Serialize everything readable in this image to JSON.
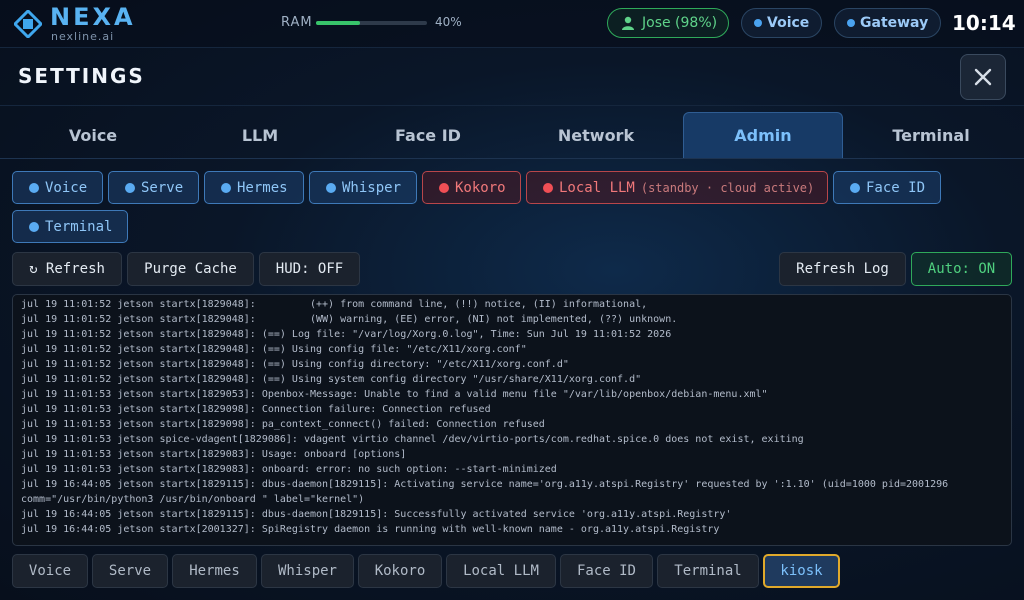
{
  "topbar": {
    "brand": "NEXA",
    "brand_sub": "nexline.ai",
    "ram_label": "RAM",
    "ram_value": 0.4,
    "ram_pct_text": "40%",
    "user_label": "Jose (98%)",
    "voice_label": "Voice",
    "gateway_label": "Gateway",
    "clock": "10:14",
    "colors": {
      "accent": "#59b3f2",
      "ok": "#38c46a",
      "error": "#f04f55"
    }
  },
  "settings": {
    "title": "SETTINGS",
    "close_icon": "close-icon"
  },
  "tabs": [
    "Voice",
    "LLM",
    "Face ID",
    "Network",
    "Admin",
    "Terminal"
  ],
  "active_tab": "Admin",
  "services": [
    {
      "label": "Voice",
      "status": "running"
    },
    {
      "label": "Serve",
      "status": "running"
    },
    {
      "label": "Hermes",
      "status": "running"
    },
    {
      "label": "Whisper",
      "status": "running"
    },
    {
      "label": "Kokoro",
      "status": "stopped"
    },
    {
      "label": "Local LLM",
      "note": "(standby · cloud active)",
      "status": "stopped"
    },
    {
      "label": "Face ID",
      "status": "running"
    },
    {
      "label": "Terminal",
      "status": "running"
    }
  ],
  "actions": {
    "refresh": "↻ Refresh",
    "purge_cache": "Purge Cache",
    "hud": "HUD: OFF",
    "refresh_log": "Refresh Log",
    "auto": "Auto: ON"
  },
  "log_lines": [
    "jul 19 11:01:52 jetson startx[1829048]:         (++) from command line, (!!) notice, (II) informational,",
    "jul 19 11:01:52 jetson startx[1829048]:         (WW) warning, (EE) error, (NI) not implemented, (??) unknown.",
    "jul 19 11:01:52 jetson startx[1829048]: (==) Log file: \"/var/log/Xorg.0.log\", Time: Sun Jul 19 11:01:52 2026",
    "jul 19 11:01:52 jetson startx[1829048]: (==) Using config file: \"/etc/X11/xorg.conf\"",
    "jul 19 11:01:52 jetson startx[1829048]: (==) Using config directory: \"/etc/X11/xorg.conf.d\"",
    "jul 19 11:01:52 jetson startx[1829048]: (==) Using system config directory \"/usr/share/X11/xorg.conf.d\"",
    "jul 19 11:01:53 jetson startx[1829053]: Openbox-Message: Unable to find a valid menu file \"/var/lib/openbox/debian-menu.xml\"",
    "jul 19 11:01:53 jetson startx[1829098]: Connection failure: Connection refused",
    "jul 19 11:01:53 jetson startx[1829098]: pa_context_connect() failed: Connection refused",
    "jul 19 11:01:53 jetson spice-vdagent[1829086]: vdagent virtio channel /dev/virtio-ports/com.redhat.spice.0 does not exist, exiting",
    "jul 19 11:01:53 jetson startx[1829083]: Usage: onboard [options]",
    "jul 19 11:01:53 jetson startx[1829083]: onboard: error: no such option: --start-minimized",
    "jul 19 16:44:05 jetson startx[1829115]: dbus-daemon[1829115]: Activating service name='org.a11y.atspi.Registry' requested by ':1.10' (uid=1000 pid=2001296",
    "comm=\"/usr/bin/python3 /usr/bin/onboard \" label=\"kernel\")",
    "jul 19 16:44:05 jetson startx[1829115]: dbus-daemon[1829115]: Successfully activated service 'org.a11y.atspi.Registry'",
    "jul 19 16:44:05 jetson startx[2001327]: SpiRegistry daemon is running with well-known name - org.a11y.atspi.Registry"
  ],
  "log_tabs": [
    "Voice",
    "Serve",
    "Hermes",
    "Whisper",
    "Kokoro",
    "Local LLM",
    "Face ID",
    "Terminal",
    "kiosk"
  ],
  "active_log_tab": "kiosk"
}
